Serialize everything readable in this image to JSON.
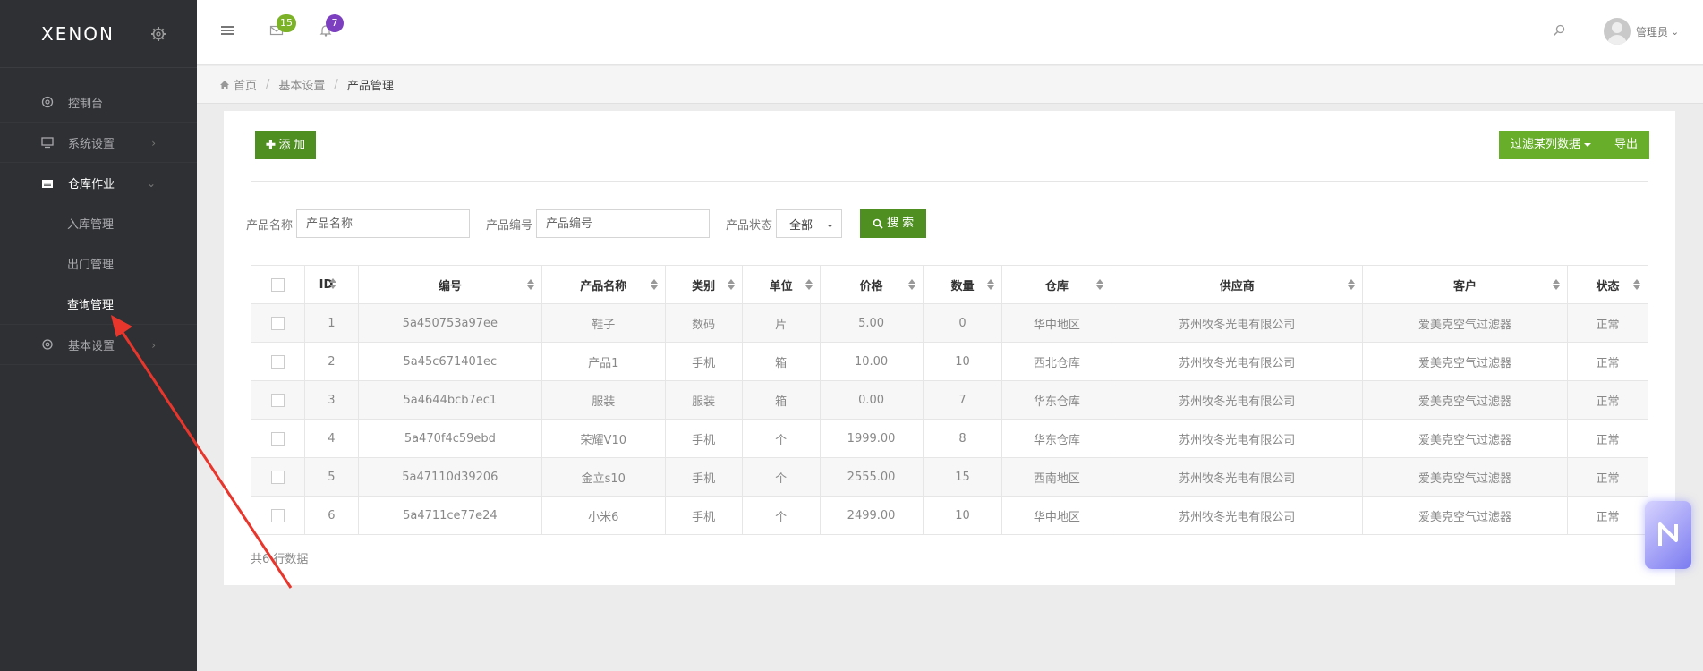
{
  "brand": {
    "name": "XENON"
  },
  "sidebar": {
    "items": [
      {
        "label": "控制台",
        "icon": "dashboard-icon"
      },
      {
        "label": "系统设置",
        "icon": "monitor-icon"
      },
      {
        "label": "仓库作业",
        "icon": "warehouse-icon"
      },
      {
        "label": "基本设置",
        "icon": "gear-icon"
      }
    ],
    "subitems": [
      {
        "label": "入库管理"
      },
      {
        "label": "出门管理"
      },
      {
        "label": "查询管理"
      }
    ]
  },
  "topbar": {
    "mail_badge": "15",
    "bell_badge": "7",
    "user_name": "管理员"
  },
  "breadcrumb": {
    "home": "首页",
    "level1": "基本设置",
    "current": "产品管理"
  },
  "toolbar": {
    "add_label": "添 加",
    "filter_label": "过滤某列数据",
    "export_label": "导出"
  },
  "search": {
    "name_label": "产品名称",
    "name_placeholder": "产品名称",
    "code_label": "产品编号",
    "code_placeholder": "产品编号",
    "status_label": "产品状态",
    "status_value": "全部",
    "button_label": "搜 索"
  },
  "table": {
    "headers": [
      "ID",
      "编号",
      "产品名称",
      "类别",
      "单位",
      "价格",
      "数量",
      "仓库",
      "供应商",
      "客户",
      "状态"
    ],
    "rows": [
      [
        "1",
        "5a450753a97ee",
        "鞋子",
        "数码",
        "片",
        "5.00",
        "0",
        "华中地区",
        "苏州牧冬光电有限公司",
        "爱美克空气过滤器",
        "正常"
      ],
      [
        "2",
        "5a45c671401ec",
        "产品1",
        "手机",
        "箱",
        "10.00",
        "10",
        "西北仓库",
        "苏州牧冬光电有限公司",
        "爱美克空气过滤器",
        "正常"
      ],
      [
        "3",
        "5a4644bcb7ec1",
        "服装",
        "服装",
        "箱",
        "0.00",
        "7",
        "华东仓库",
        "苏州牧冬光电有限公司",
        "爱美克空气过滤器",
        "正常"
      ],
      [
        "4",
        "5a470f4c59ebd",
        "荣耀V10",
        "手机",
        "个",
        "1999.00",
        "8",
        "华东仓库",
        "苏州牧冬光电有限公司",
        "爱美克空气过滤器",
        "正常"
      ],
      [
        "5",
        "5a47110d39206",
        "金立s10",
        "手机",
        "个",
        "2555.00",
        "15",
        "西南地区",
        "苏州牧冬光电有限公司",
        "爱美克空气过滤器",
        "正常"
      ],
      [
        "6",
        "5a4711ce77e24",
        "小米6",
        "手机",
        "个",
        "2499.00",
        "10",
        "华中地区",
        "苏州牧冬光电有限公司",
        "爱美克空气过滤器",
        "正常"
      ]
    ],
    "footer": "共6 行数据"
  },
  "colors": {
    "sidebar_bg": "#2f3033",
    "primary_green": "#4f8f21",
    "light_green": "#68ae2b",
    "annotation_red": "#e8362d"
  }
}
